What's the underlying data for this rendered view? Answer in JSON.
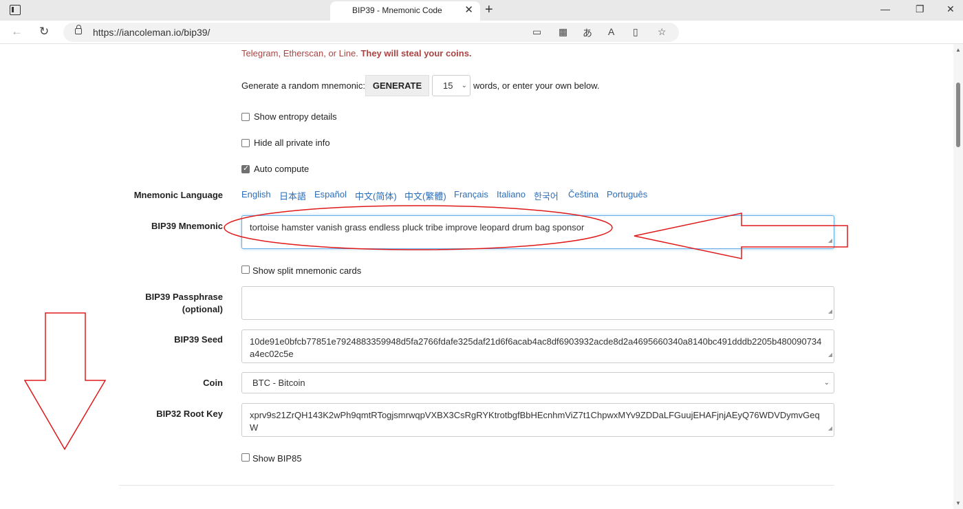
{
  "browser": {
    "tab_title": "BIP39 - Mnemonic Code",
    "url": "https://iancoleman.io/bip39/"
  },
  "warning": {
    "line1": "Telegram, Etherscan, or Line.",
    "line1_bold": "They will steal your coins."
  },
  "generate": {
    "prefix": "Generate a random mnemonic:",
    "button_label": "GENERATE",
    "word_count": "15",
    "suffix": "words, or enter your own below."
  },
  "options": {
    "show_entropy": "Show entropy details",
    "hide_private": "Hide all private info",
    "auto_compute": "Auto compute",
    "auto_compute_checked": true,
    "show_split_cards": "Show split mnemonic cards",
    "show_bip85": "Show BIP85"
  },
  "labels": {
    "mnemonic_language": "Mnemonic Language",
    "bip39_mnemonic": "BIP39 Mnemonic",
    "bip39_passphrase": "BIP39 Passphrase",
    "bip39_passphrase_optional": "(optional)",
    "bip39_seed": "BIP39 Seed",
    "coin": "Coin",
    "bip32_root_key": "BIP32 Root Key"
  },
  "languages": [
    "English",
    "日本語",
    "Español",
    "中文(简体)",
    "中文(繁體)",
    "Français",
    "Italiano",
    "한국어",
    "Čeština",
    "Português"
  ],
  "fields": {
    "mnemonic": "tortoise hamster vanish grass endless pluck tribe improve leopard drum bag sponsor",
    "passphrase": "",
    "seed": "10de91e0bfcb77851e7924883359948d5fa2766fdafe325daf21d6f6acab4ac8df6903932acde8d2a4695660340a8140bc491dddb2205b480090734a4ec02c5e",
    "coin": "BTC - Bitcoin",
    "root_key": "xprv9s21ZrQH143K2wPh9qmtRTogjsmrwqpVXBX3CsRgRYKtrotbgfBbHEcnhmViZ7t1ChpwxMYv9ZDDaLFGuujEHAFjnjAEyQ76WDVDymvGeqW"
  },
  "colors": {
    "warning": "#a94442",
    "link": "#2a6ebb",
    "annotation": "#e01818"
  }
}
